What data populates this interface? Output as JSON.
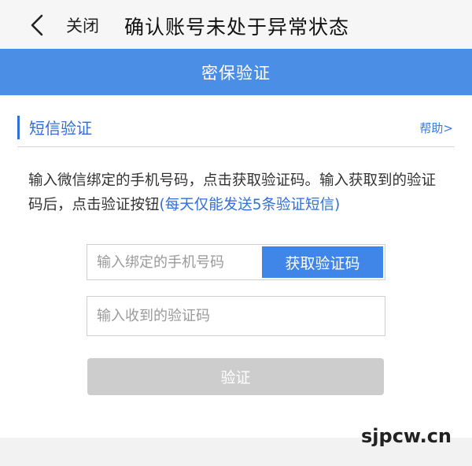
{
  "nav": {
    "back_icon": "chevron-left-icon",
    "close_label": "关闭",
    "title": "确认账号未处于异常状态"
  },
  "section": {
    "title": "密保验证",
    "color": "#4a8ee6"
  },
  "card": {
    "title": "短信验证",
    "help_label": "帮助>",
    "description": "输入微信绑定的手机号码，点击获取验证码。输入获取到的验证码后，点击验证按钮",
    "description_highlight": "(每天仅能发送5条验证短信)"
  },
  "form": {
    "phone_placeholder": "输入绑定的手机号码",
    "phone_value": "",
    "get_code_label": "获取验证码",
    "code_placeholder": "输入收到的验证码",
    "code_value": "",
    "verify_label": "验证"
  },
  "watermark": {
    "text": "sjpcw.cn"
  },
  "colors": {
    "accent": "#3f86e8",
    "link": "#2f6fd6",
    "disabled": "#cdcdcd"
  }
}
